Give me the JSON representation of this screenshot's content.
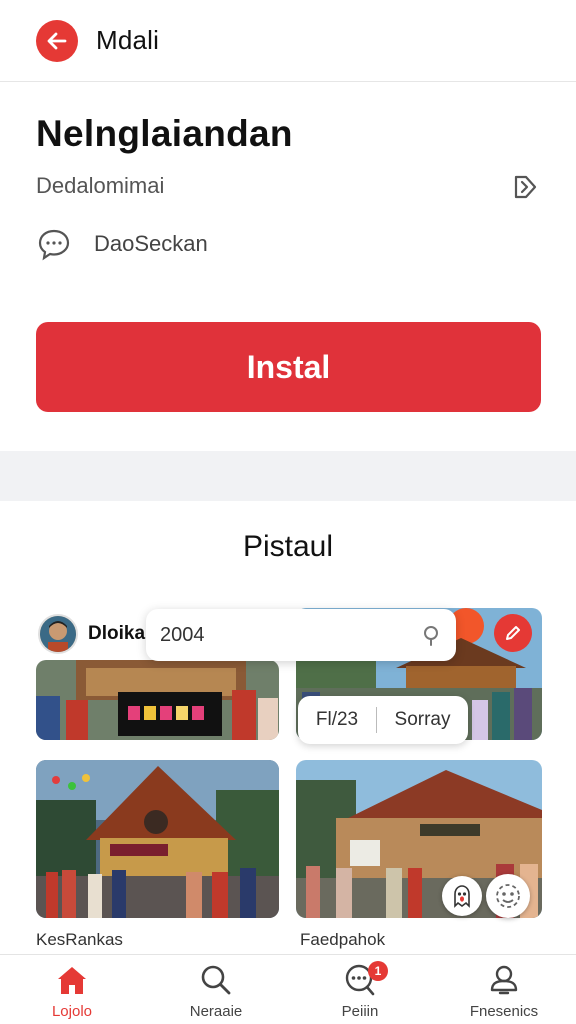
{
  "appbar": {
    "title": "Mdali",
    "back_icon": "arrow-left-icon"
  },
  "app": {
    "name": "Nelnglaiandan",
    "subtitle": "Dedalomimai",
    "chat_label": "DaoSeckan",
    "install_label": "Instal"
  },
  "section": {
    "title": "Pistaul",
    "author_name": "Dloikal",
    "search_value": "2004",
    "chip": {
      "left": "Fl/23",
      "right": "Sorray"
    },
    "captions": [
      "KesRankas",
      "Faedpahok"
    ]
  },
  "bottom_nav": [
    {
      "label": "Lojolo",
      "icon": "home-icon",
      "active": true
    },
    {
      "label": "Neraaie",
      "icon": "search-icon",
      "active": false
    },
    {
      "label": "Peiiin",
      "icon": "chat-icon",
      "active": false,
      "badge": "1"
    },
    {
      "label": "Fnesenics",
      "icon": "user-icon",
      "active": false
    }
  ],
  "colors": {
    "accent": "#e53935",
    "install": "#e0323a",
    "separator": "#f1f2f4"
  }
}
